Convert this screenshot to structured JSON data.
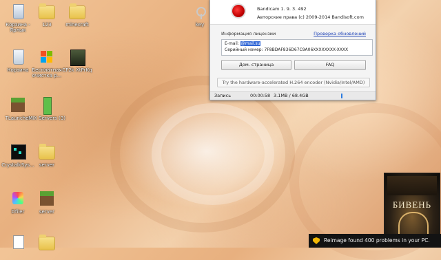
{
  "desktop": {
    "icons": [
      {
        "label": "Корзина - Ярлык"
      },
      {
        "label": "123"
      },
      {
        "label": "minecraft"
      },
      {
        "label": "Корзина"
      },
      {
        "label": "Бесплатная очистка р..."
      },
      {
        "label": "CF2k XtPrKq"
      },
      {
        "label": "TLauncher"
      },
      {
        "label": "MIX Servers (3)"
      },
      {
        "label": "CrystalkSys..."
      },
      {
        "label": "server"
      },
      {
        "label": "Dfiler"
      },
      {
        "label": "server"
      },
      {
        "label": "key"
      }
    ]
  },
  "bandicam": {
    "product_line": "Bandicam 1. 9. 3. 492",
    "copyright_line": "Авторские права (c) 2009-2014 Bandisoft.com",
    "license_label": "Информация лицензии",
    "check_updates_link": "Проверка обновлений",
    "email_label": "E-mail:",
    "email_value": "@mail.su",
    "serial_label": "Серийный номер:",
    "serial_value": "7F8BDAF836D67C9A06XXXXXXXX-XXXX",
    "home_button": "Дом. страница",
    "faq_button": "FAQ",
    "hint_text": "Try the hardware-accelerated H.264 encoder (Nvidia/Intel/AMD)",
    "status": {
      "label": "Запись",
      "time": "00:00:58",
      "size": "3.1MB / 68.4GB"
    }
  },
  "movie_tile": {
    "title": "БИВЕНЬ"
  },
  "notification": {
    "text": "Reimage found 400 problems in your PC."
  }
}
